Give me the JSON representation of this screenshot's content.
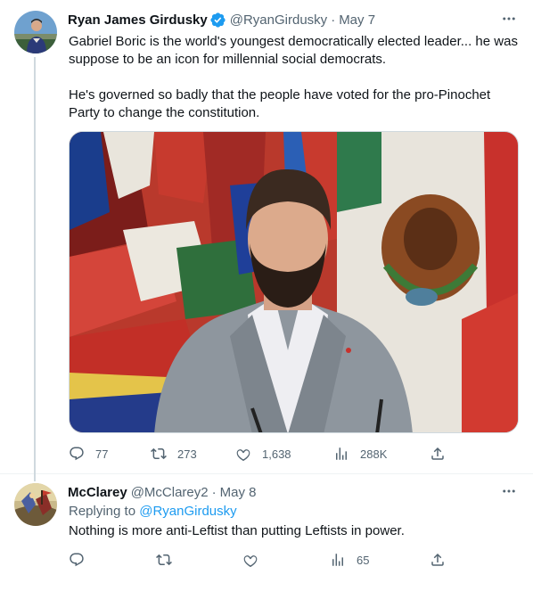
{
  "colors": {
    "accent": "#1d9bf0",
    "secondary_text": "#536471",
    "primary_text": "#0f1419",
    "thread_line": "#cfd9de"
  },
  "tweet": {
    "author_name": "Ryan James Girdusky",
    "verified": true,
    "handle": "@RyanGirdusky",
    "separator": "·",
    "date": "May 7",
    "text_p1": "Gabriel Boric is the world's youngest democratically elected leader... he was suppose to be an icon for millennial social democrats.",
    "text_p2": "He's governed so badly that the people have voted for the pro-Pinochet Party to change the constitution.",
    "media_icon": "photo-of-man-in-suit-before-flags",
    "stats": {
      "replies": "77",
      "retweets": "273",
      "likes": "1,638",
      "views": "288K"
    }
  },
  "reply": {
    "author_name": "McClarey",
    "handle": "@McClarey2",
    "separator": "·",
    "date": "May 8",
    "replying_prefix": "Replying to ",
    "replying_to": "@RyanGirdusky",
    "text": "Nothing is more anti-Leftist than putting Leftists in power.",
    "stats": {
      "replies": "",
      "retweets": "",
      "likes": "",
      "views": "65"
    }
  }
}
